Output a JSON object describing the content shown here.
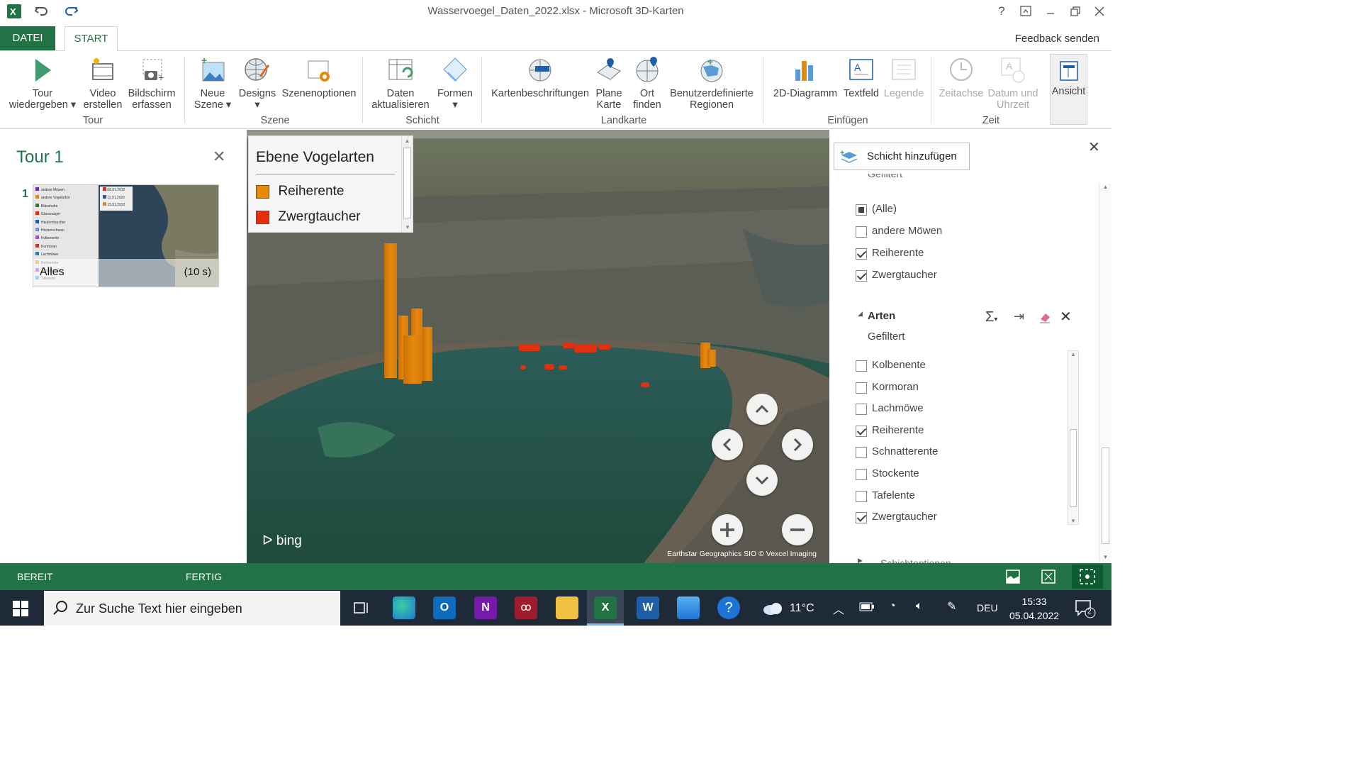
{
  "window": {
    "title": "Wasservoegel_Daten_2022.xlsx - Microsoft 3D-Karten",
    "help": "?"
  },
  "tabs": {
    "datei": "DATEI",
    "start": "START",
    "feedback": "Feedback senden"
  },
  "ribbon": {
    "tour_play_1": "Tour",
    "tour_play_2": "wiedergeben",
    "video_1": "Video",
    "video_2": "erstellen",
    "screenshot_1": "Bildschirm",
    "screenshot_2": "erfassen",
    "group_tour": "Tour",
    "newscene_1": "Neue",
    "newscene_2": "Szene",
    "designs": "Designs",
    "sceneopts": "Szenenoptionen",
    "group_szene": "Szene",
    "refresh_1": "Daten",
    "refresh_2": "aktualisieren",
    "shapes": "Formen",
    "group_schicht": "Schicht",
    "maplabels": "Kartenbeschriftungen",
    "flatmap_1": "Plane",
    "flatmap_2": "Karte",
    "find_1": "Ort",
    "find_2": "finden",
    "regions_1": "Benutzerdefinierte",
    "regions_2": "Regionen",
    "group_landkarte": "Landkarte",
    "chart2d": "2D-Diagramm",
    "textbox": "Textfeld",
    "legend": "Legende",
    "group_einfuegen": "Einfügen",
    "timeline": "Zeitachse",
    "datetime_1": "Datum und",
    "datetime_2": "Uhrzeit",
    "group_zeit": "Zeit",
    "view": "Ansicht"
  },
  "tour": {
    "title": "Tour 1",
    "scene_number": "1",
    "scene_name": "Alles",
    "scene_duration": "(10 s)",
    "thumb_legend": [
      "andere Möwen",
      "andere Vogelarten",
      "Blässhuhn",
      "Gänsesäger",
      "Haubentaucher",
      "Höckerschwan",
      "Kolbenente",
      "Kormoran",
      "Lachmöwe",
      "Reiherente",
      "Schnatterente",
      "Tafelente"
    ],
    "thumb_dates": [
      "08.01.2022",
      "11.01.2022",
      "15.01.2022"
    ]
  },
  "legend": {
    "title": "Ebene Vogelarten",
    "items": [
      {
        "label": "Reiherente",
        "color": "#e8890c"
      },
      {
        "label": "Zwergtaucher",
        "color": "#e0300f"
      }
    ]
  },
  "map": {
    "bing": "bing",
    "attribution": "Earthstar Geographics  SIO  © Vexcel Imaging"
  },
  "panel": {
    "add_layer": "Schicht hinzufügen",
    "filter1_header_partial": "Gefiltert",
    "filter1": [
      {
        "label": "(Alle)",
        "state": "part"
      },
      {
        "label": "andere Möwen",
        "state": "off"
      },
      {
        "label": "Reiherente",
        "state": "on"
      },
      {
        "label": "Zwergtaucher",
        "state": "on"
      }
    ],
    "arten_title": "Arten",
    "arten_sub": "Gefiltert",
    "filter2": [
      {
        "label": "Kolbenente",
        "state": "off"
      },
      {
        "label": "Kormoran",
        "state": "off"
      },
      {
        "label": "Lachmöwe",
        "state": "off"
      },
      {
        "label": "Reiherente",
        "state": "on"
      },
      {
        "label": "Schnatterente",
        "state": "off"
      },
      {
        "label": "Stockente",
        "state": "off"
      },
      {
        "label": "Tafelente",
        "state": "off"
      },
      {
        "label": "Zwergtaucher",
        "state": "on"
      }
    ],
    "footer_partial": "Schichtoptionen"
  },
  "status": {
    "ready": "BEREIT",
    "done": "FERTIG"
  },
  "taskbar": {
    "search_placeholder": "Zur Suche Text hier eingeben",
    "weather": "11°C",
    "lang": "DEU",
    "time": "15:33",
    "date": "05.04.2022",
    "notifications": "2"
  }
}
